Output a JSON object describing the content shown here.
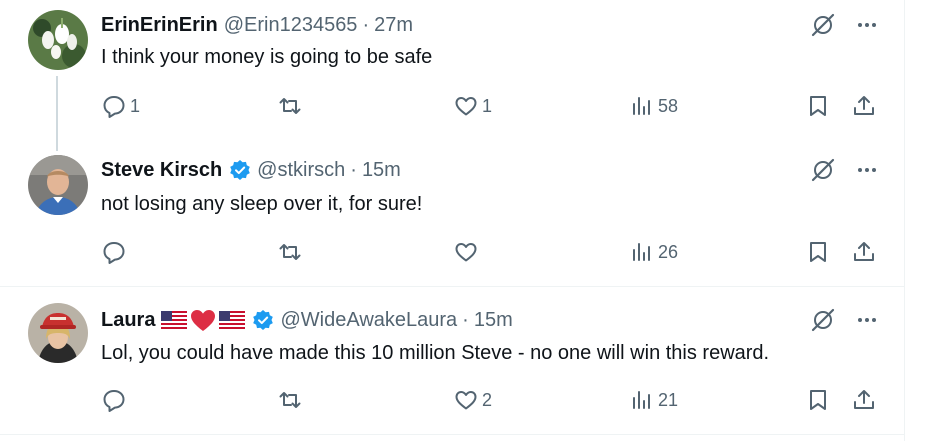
{
  "tweets": [
    {
      "name": "ErinErinErin",
      "handle": "@Erin1234565",
      "separator": "·",
      "time": "27m",
      "text": "I think your money is going to be safe",
      "reply_count": "1",
      "retweet_count": "",
      "like_count": "1",
      "view_count": "58",
      "verified": false
    },
    {
      "name": "Steve Kirsch",
      "handle": "@stkirsch",
      "separator": "·",
      "time": "15m",
      "text": "not losing any sleep over it, for sure!",
      "reply_count": "",
      "retweet_count": "",
      "like_count": "",
      "view_count": "26",
      "verified": true
    },
    {
      "name": "Laura",
      "name_emoji": [
        "us-flag",
        "red-heart",
        "us-flag"
      ],
      "handle": "@WideAwakeLaura",
      "separator": "·",
      "time": "15m",
      "text": "Lol, you could have made this 10 million Steve - no one will win this reward.",
      "reply_count": "",
      "retweet_count": "",
      "like_count": "2",
      "view_count": "21",
      "verified": true
    }
  ],
  "icons": {
    "top": [
      "grok-icon",
      "more-icon"
    ],
    "actions": [
      "reply-icon",
      "retweet-icon",
      "like-icon",
      "views-icon",
      "bookmark-icon",
      "share-icon"
    ]
  },
  "colors": {
    "text": "#0f1419",
    "secondary": "#536471",
    "verified": "#1d9bf0",
    "divider": "#eff3f4"
  }
}
